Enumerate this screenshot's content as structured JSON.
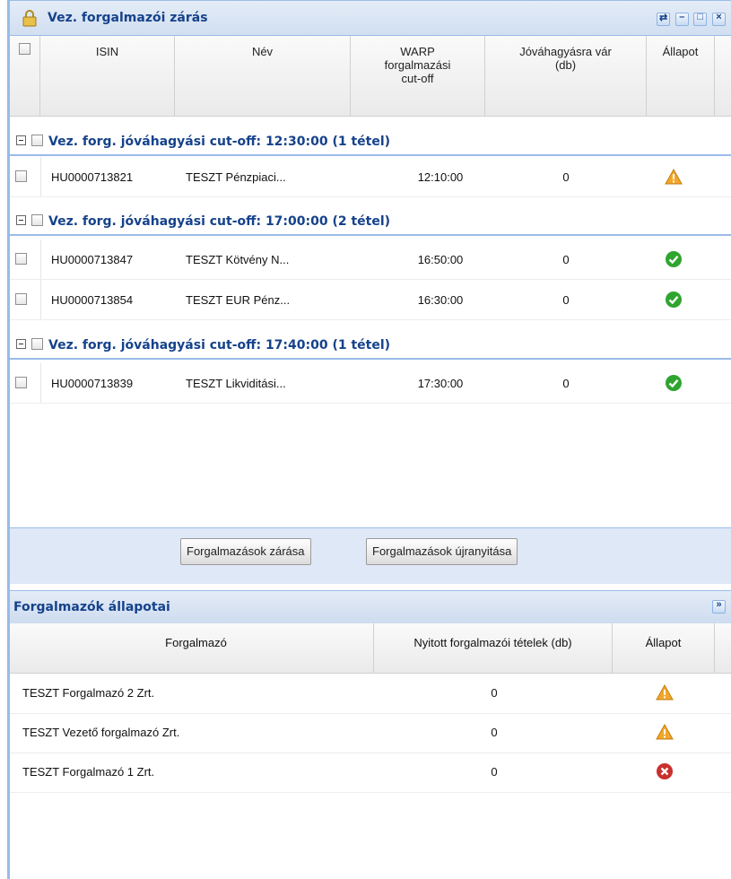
{
  "window": {
    "title": "Vez. forgalmazói zárás"
  },
  "grid": {
    "columns": {
      "isin": "ISIN",
      "nev": "Név",
      "warp": [
        "WARP",
        "forgalmazási",
        "cut-off"
      ],
      "wait": [
        "Jóváhagyásra vár",
        "(db)"
      ],
      "status": "Állapot"
    },
    "groups": [
      {
        "label": "Vez. forg. jóváhagyási cut-off: 12:30:00 (1 tétel)",
        "rows": [
          {
            "isin": "HU0000713821",
            "name": "TESZT Pénzpiaci...",
            "cutoff": "12:10:00",
            "waiting": "0",
            "status": "warning"
          }
        ]
      },
      {
        "label": "Vez. forg. jóváhagyási cut-off: 17:00:00 (2 tétel)",
        "rows": [
          {
            "isin": "HU0000713847",
            "name": "TESZT Kötvény N...",
            "cutoff": "16:50:00",
            "waiting": "0",
            "status": "ok"
          },
          {
            "isin": "HU0000713854",
            "name": "TESZT EUR Pénz...",
            "cutoff": "16:30:00",
            "waiting": "0",
            "status": "ok"
          }
        ]
      },
      {
        "label": "Vez. forg. jóváhagyási cut-off: 17:40:00 (1 tétel)",
        "rows": [
          {
            "isin": "HU0000713839",
            "name": "TESZT Likviditási...",
            "cutoff": "17:30:00",
            "waiting": "0",
            "status": "ok"
          }
        ]
      }
    ]
  },
  "buttons": {
    "close": "Forgalmazások zárása",
    "reopen": "Forgalmazások újranyitása"
  },
  "distributors": {
    "title": "Forgalmazók állapotai",
    "columns": {
      "name": "Forgalmazó",
      "open": "Nyitott forgalmazói tételek (db)",
      "status": "Állapot"
    },
    "rows": [
      {
        "name": "TESZT Forgalmazó 2 Zrt.",
        "open": "0",
        "status": "warning"
      },
      {
        "name": "TESZT Vezető forgalmazó Zrt.",
        "open": "0",
        "status": "warning"
      },
      {
        "name": "TESZT Forgalmazó 1 Zrt.",
        "open": "0",
        "status": "error"
      }
    ]
  },
  "colors": {
    "header_blue": "#15428b",
    "border_blue": "#99bbe8",
    "ok_green": "#2fa52f",
    "warning_orange": "#f0a020",
    "error_red": "#c9302c"
  }
}
